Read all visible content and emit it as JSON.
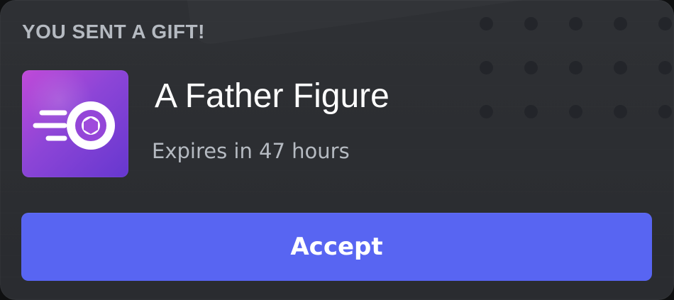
{
  "card": {
    "heading": "YOU SENT A GIFT!",
    "title": "A Father Figure",
    "subtitle": "Expires in 47 hours",
    "button_label": "Accept",
    "icon": "nitro-gift-icon"
  }
}
